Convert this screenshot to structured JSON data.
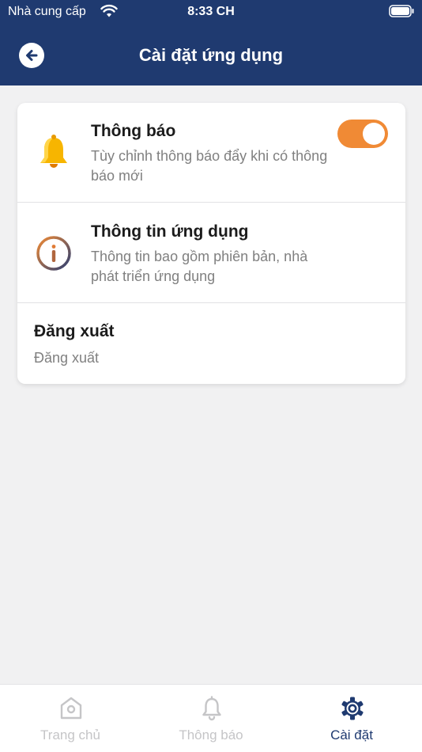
{
  "status_bar": {
    "carrier": "Nhà cung cấp",
    "time": "8:33 CH"
  },
  "header": {
    "title": "Cài đặt ứng dụng",
    "back_icon": "arrow-left-icon"
  },
  "settings": {
    "notification": {
      "icon": "bell-icon",
      "title": "Thông báo",
      "description": "Tùy chỉnh thông báo đẩy khi có thông báo mới",
      "toggle_on": true
    },
    "app_info": {
      "icon": "info-circle-icon",
      "title": "Thông tin ứng dụng",
      "description": "Thông tin bao gồm phiên bản, nhà phát triển ứng dụng"
    },
    "logout": {
      "title": "Đăng xuất",
      "description": "Đăng xuất"
    }
  },
  "tab_bar": {
    "items": [
      {
        "label": "Trang chủ",
        "icon": "home-icon",
        "active": false
      },
      {
        "label": "Thông báo",
        "icon": "bell-outline-icon",
        "active": false
      },
      {
        "label": "Cài đặt",
        "icon": "gear-icon",
        "active": true
      }
    ]
  },
  "colors": {
    "header_bg": "#1f3a70",
    "accent": "#f08a35",
    "active_tab": "#1f3a70",
    "inactive_tab": "#c5c5c7"
  }
}
